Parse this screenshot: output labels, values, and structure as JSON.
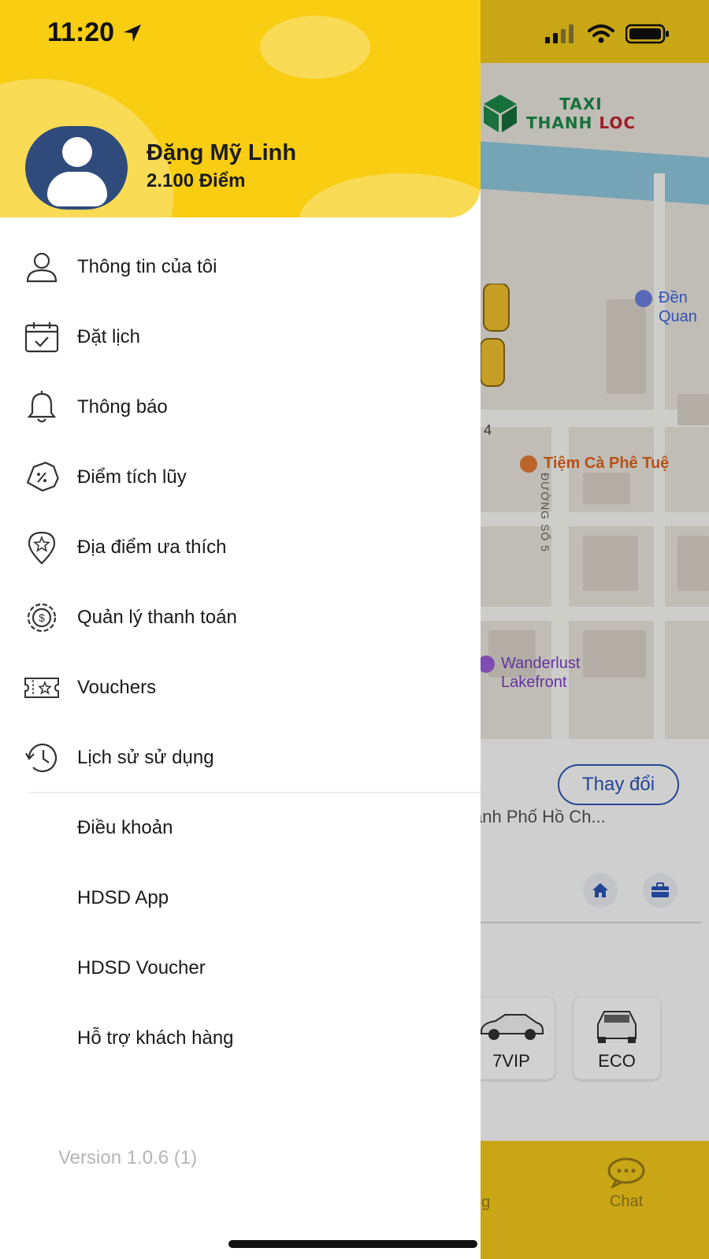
{
  "status_bar": {
    "time": "11:20"
  },
  "drawer": {
    "user": {
      "name": "Đặng Mỹ Linh",
      "points": "2.100 Điểm"
    },
    "menu": [
      {
        "label": "Thông tin của tôi",
        "icon": "user-icon"
      },
      {
        "label": "Đặt lịch",
        "icon": "calendar-check-icon"
      },
      {
        "label": "Thông báo",
        "icon": "bell-icon"
      },
      {
        "label": "Điểm tích lũy",
        "icon": "discount-tag-icon"
      },
      {
        "label": "Địa điểm ưa thích",
        "icon": "star-pin-icon"
      },
      {
        "label": "Quản lý thanh toán",
        "icon": "payment-gear-icon"
      },
      {
        "label": "Vouchers",
        "icon": "ticket-star-icon"
      },
      {
        "label": "Lịch sử sử dụng",
        "icon": "history-icon"
      }
    ],
    "secondary_menu": [
      {
        "label": "Điều khoản"
      },
      {
        "label": "HDSD App"
      },
      {
        "label": "HDSD Voucher"
      },
      {
        "label": "Hỗ trợ khách hàng"
      }
    ],
    "version": "Version 1.0.6 (1)",
    "colors": {
      "header": "#f9cd12",
      "header_blob": "#fadb56",
      "avatar": "#2f4b7c"
    }
  },
  "background_app": {
    "logo": {
      "line1": "TAXI",
      "line2_part1": "THANH ",
      "line2_part2": "LOC"
    },
    "pois": [
      {
        "line1": "Đền",
        "line2": "Quan",
        "color": "#3c64d8"
      },
      {
        "line1": "Tiệm Cà Phê Tuệ",
        "color": "#e0641a"
      },
      {
        "line1": "Wanderlust",
        "line2": "Lakefront",
        "color": "#7b3fc2"
      }
    ],
    "street": "ĐƯỜNG SỐ 5",
    "street_number": "4",
    "change_button": "Thay đổi",
    "address": "ành Phố Hồ Ch...",
    "car_types": [
      {
        "label": "7VIP"
      },
      {
        "label": "ECO"
      }
    ],
    "tabs": {
      "chat": "Chat",
      "partial": "ng"
    }
  }
}
